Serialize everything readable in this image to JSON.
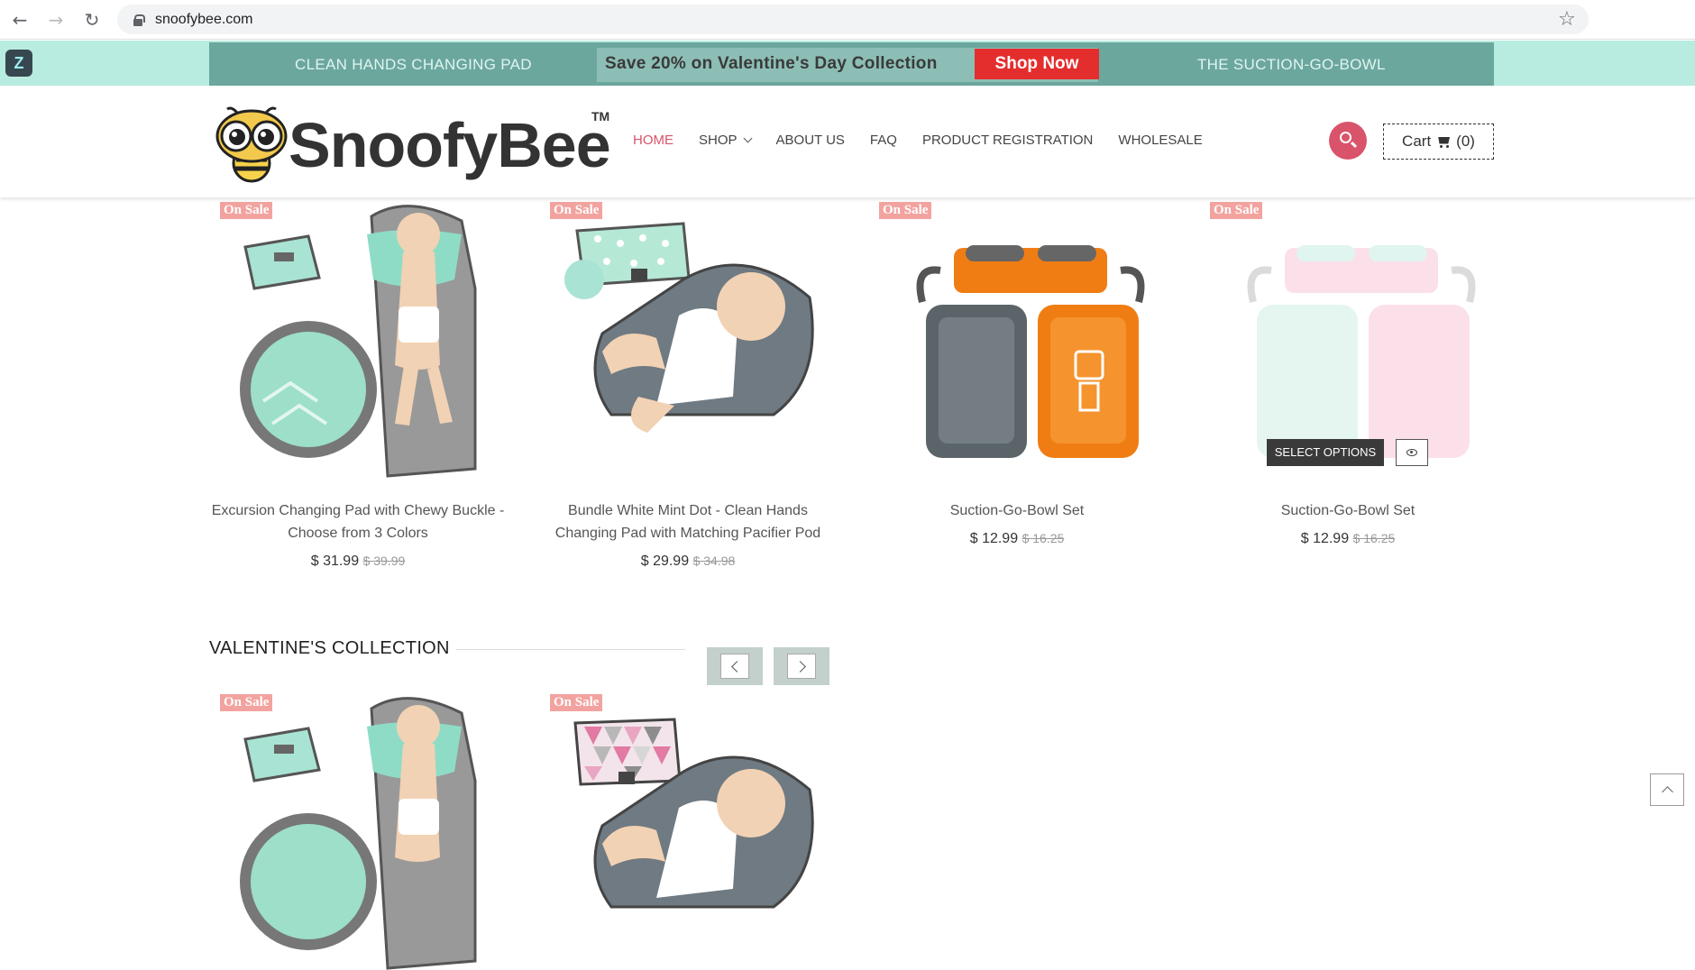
{
  "browser": {
    "url": "snoofybee.com",
    "back_icon": "←",
    "forward_icon": "→",
    "reload_icon": "↻",
    "star_icon": "☆"
  },
  "promo": {
    "slide_left": "CLEAN HANDS CHANGING PAD",
    "headline": "Save 20% on Valentine's Day Collection",
    "cta": "Shop Now",
    "slide_right": "THE SUCTION-GO-BOWL",
    "cta_color": "#e42d2d"
  },
  "header": {
    "logo_text": "SnoofyBee",
    "logo_tm": "TM",
    "nav": [
      {
        "label": "HOME",
        "active": true
      },
      {
        "label": "SHOP",
        "dropdown": true
      },
      {
        "label": "ABOUT US"
      },
      {
        "label": "FAQ"
      },
      {
        "label": "PRODUCT REGISTRATION"
      },
      {
        "label": "WHOLESALE"
      }
    ],
    "cart_label": "Cart",
    "cart_count": "(0)",
    "accent_color": "#d9536b"
  },
  "products": [
    {
      "badge": "On Sale",
      "title": "Excursion Changing Pad with Chewy Buckle - Choose from 3 Colors",
      "price": "$ 31.99",
      "old_price": "$ 39.99"
    },
    {
      "badge": "On Sale",
      "title": "Bundle White Mint Dot - Clean Hands Changing Pad with Matching Pacifier Pod",
      "price": "$ 29.99",
      "old_price": "$ 34.98"
    },
    {
      "badge": "On Sale",
      "title": "Suction-Go-Bowl Set",
      "price": "$ 12.99",
      "old_price": "$ 16.25"
    },
    {
      "badge": "On Sale",
      "title": "Suction-Go-Bowl Set",
      "price": "$ 12.99",
      "old_price": "$ 16.25"
    }
  ],
  "hover_actions": {
    "select_options": "SELECT OPTIONS",
    "quick_view_icon": "eye-icon"
  },
  "valentines": {
    "title": "VALENTINE'S COLLECTION",
    "products": [
      {
        "badge": "On Sale"
      },
      {
        "badge": "On Sale"
      }
    ]
  }
}
